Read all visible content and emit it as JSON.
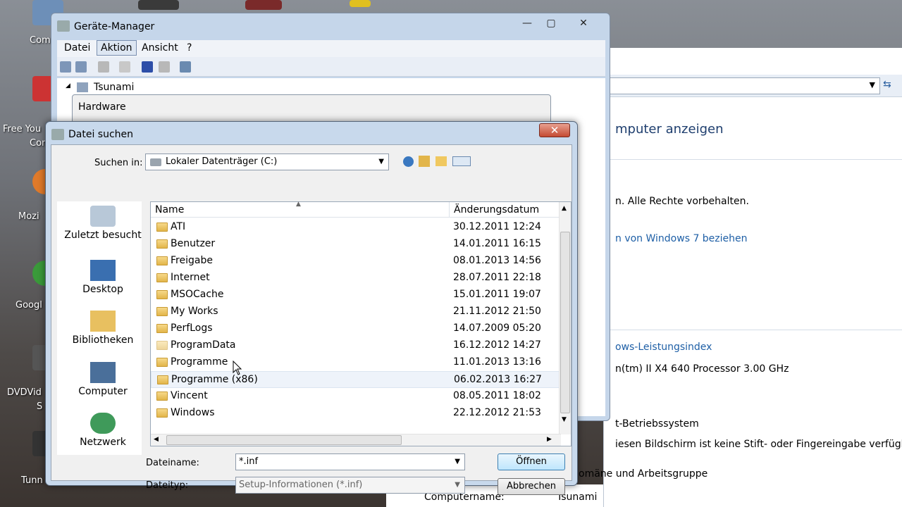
{
  "desktop": {
    "icons": [
      "Comp",
      "Free You",
      "Com",
      "Mozi",
      "Googl",
      "DVDVid",
      "S",
      "Tunn"
    ]
  },
  "system_window": {
    "heading": "mputer anzeigen",
    "copyright": "n. Alle Rechte vorbehalten.",
    "link_features": "n von Windows 7 beziehen",
    "link_index": "ows-Leistungsindex",
    "processor": "n(tm) II X4 640 Processor   3.00 GHz",
    "os_type": "t-Betriebssystem",
    "pen_info": "iesen Bildschirm ist keine Stift- oder Fingereingabe verfügbar.",
    "section_domain": "omäne und Arbeitsgruppe",
    "computer_name_label": "Computername:",
    "computer_name_value": "Tsunami"
  },
  "device_manager": {
    "title": "Geräte-Manager",
    "menu": [
      "Datei",
      "Aktion",
      "Ansicht",
      "?"
    ],
    "tree_root": "Tsunami"
  },
  "hardware_wizard": {
    "title": "Hardware"
  },
  "file_dialog": {
    "title": "Datei suchen",
    "look_in_label": "Suchen in:",
    "look_in_value": "Lokaler Datenträger (C:)",
    "places": [
      "Zuletzt besucht",
      "Desktop",
      "Bibliotheken",
      "Computer",
      "Netzwerk"
    ],
    "columns": {
      "name": "Name",
      "date": "Änderungsdatum"
    },
    "files": [
      {
        "name": "ATI",
        "date": "30.12.2011 12:24"
      },
      {
        "name": "Benutzer",
        "date": "14.01.2011 16:15"
      },
      {
        "name": "Freigabe",
        "date": "08.01.2013 14:56"
      },
      {
        "name": "Internet",
        "date": "28.07.2011 22:18"
      },
      {
        "name": "MSOCache",
        "date": "15.01.2011 19:07"
      },
      {
        "name": "My Works",
        "date": "21.11.2012 21:50"
      },
      {
        "name": "PerfLogs",
        "date": "14.07.2009 05:20"
      },
      {
        "name": "ProgramData",
        "date": "16.12.2012 14:27"
      },
      {
        "name": "Programme",
        "date": "11.01.2013 13:16"
      },
      {
        "name": "Programme (x86)",
        "date": "06.02.2013 16:27"
      },
      {
        "name": "Vincent",
        "date": "08.05.2011 18:02"
      },
      {
        "name": "Windows",
        "date": "22.12.2012 21:53"
      }
    ],
    "filename_label": "Dateiname:",
    "filename_value": "*.inf",
    "filetype_label": "Dateityp:",
    "filetype_value": "Setup-Informationen (*.inf)",
    "open_button": "Öffnen",
    "cancel_button": "Abbrechen"
  },
  "colors": {
    "link": "#1e5fa6",
    "selection": "#eef3fa"
  }
}
